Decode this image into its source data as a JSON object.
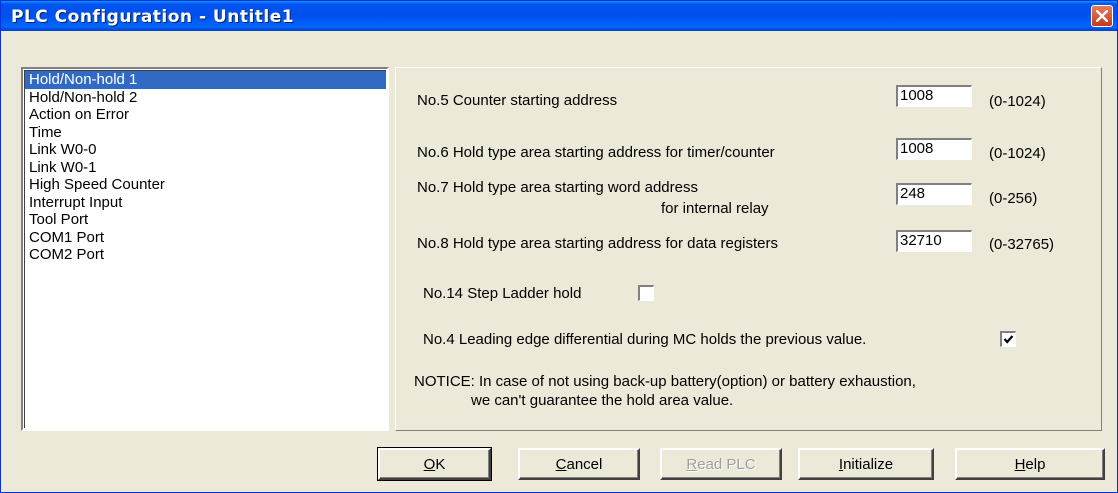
{
  "window": {
    "title": "PLC Configuration - Untitle1"
  },
  "sidebar": {
    "items": [
      {
        "label": "Hold/Non-hold 1",
        "selected": true
      },
      {
        "label": "Hold/Non-hold 2"
      },
      {
        "label": "Action on Error"
      },
      {
        "label": "Time"
      },
      {
        "label": "Link W0-0"
      },
      {
        "label": "Link W0-1"
      },
      {
        "label": "High Speed Counter"
      },
      {
        "label": "Interrupt Input"
      },
      {
        "label": "Tool Port"
      },
      {
        "label": "COM1 Port"
      },
      {
        "label": "COM2 Port"
      }
    ]
  },
  "settings": {
    "no5": {
      "label": "No.5 Counter starting address",
      "value": "1008",
      "range": "(0-1024)"
    },
    "no6": {
      "label": "No.6 Hold type area starting address for timer/counter",
      "value": "1008",
      "range": "(0-1024)"
    },
    "no7": {
      "label_line1": "No.7 Hold type area starting word address",
      "label_line2": "for internal relay",
      "value": "248",
      "range": "(0-256)"
    },
    "no8": {
      "label": "No.8 Hold type area starting address for data registers",
      "value": "32710",
      "range": "(0-32765)"
    },
    "no14": {
      "label": "No.14 Step Ladder hold",
      "checked": false
    },
    "no4": {
      "label": "No.4 Leading edge differential during MC holds the previous value.",
      "checked": true
    },
    "notice_line1": "NOTICE: In case of not using back-up battery(option) or battery exhaustion,",
    "notice_line2": "we can't guarantee the hold area value."
  },
  "buttons": {
    "ok": {
      "label": "OK",
      "mnemonic": "O",
      "rest": "K"
    },
    "cancel": {
      "label": "Cancel",
      "mnemonic": "C",
      "rest": "ancel"
    },
    "read_plc": {
      "label": "Read PLC",
      "mnemonic": "R",
      "rest": "ead PLC",
      "disabled": true
    },
    "initialize": {
      "label": "Initialize",
      "mnemonic": "I",
      "rest": "nitialize"
    },
    "help": {
      "label": "Help",
      "mnemonic": "H",
      "rest": "elp"
    }
  }
}
